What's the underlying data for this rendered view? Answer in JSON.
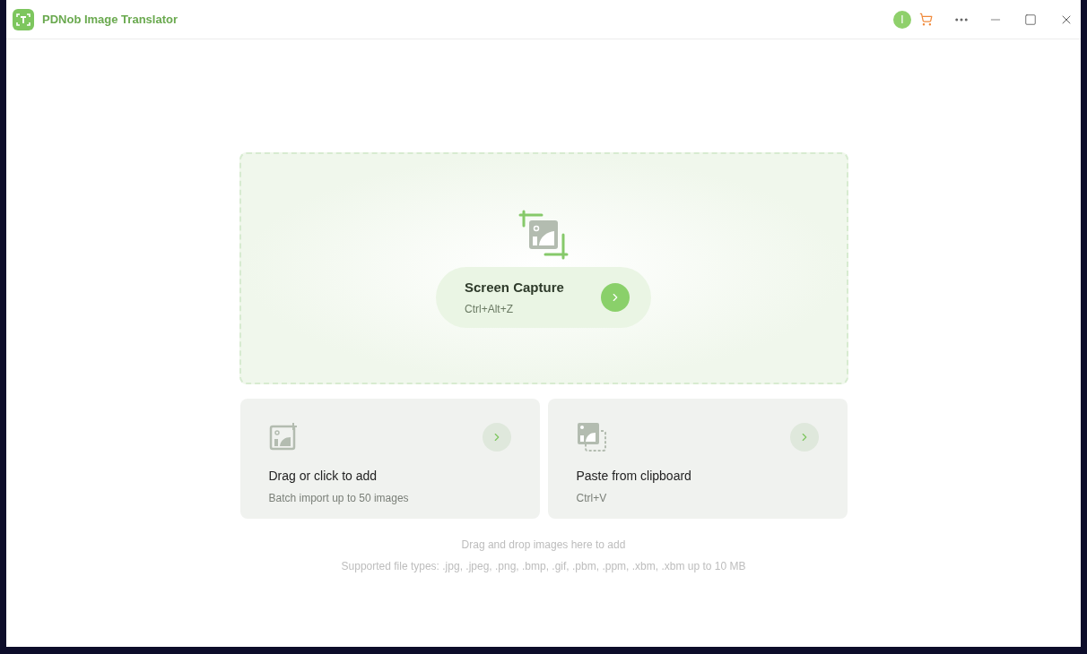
{
  "window": {
    "title": "PDNob Image Translator",
    "avatar": "I"
  },
  "capture": {
    "title": "Screen Capture",
    "shortcut": "Ctrl+Alt+Z"
  },
  "options": [
    {
      "kind": "add",
      "title": "Drag or click to add",
      "subtitle": "Batch import up to 50 images"
    },
    {
      "kind": "paste",
      "title": "Paste from clipboard",
      "subtitle": "Ctrl+V"
    }
  ],
  "hints": [
    "Drag and drop images here to add",
    "Supported file types: .jpg, .jpeg, .png, .bmp, .gif, .pbm, .ppm, .xbm, .xbm up to 10 MB"
  ]
}
